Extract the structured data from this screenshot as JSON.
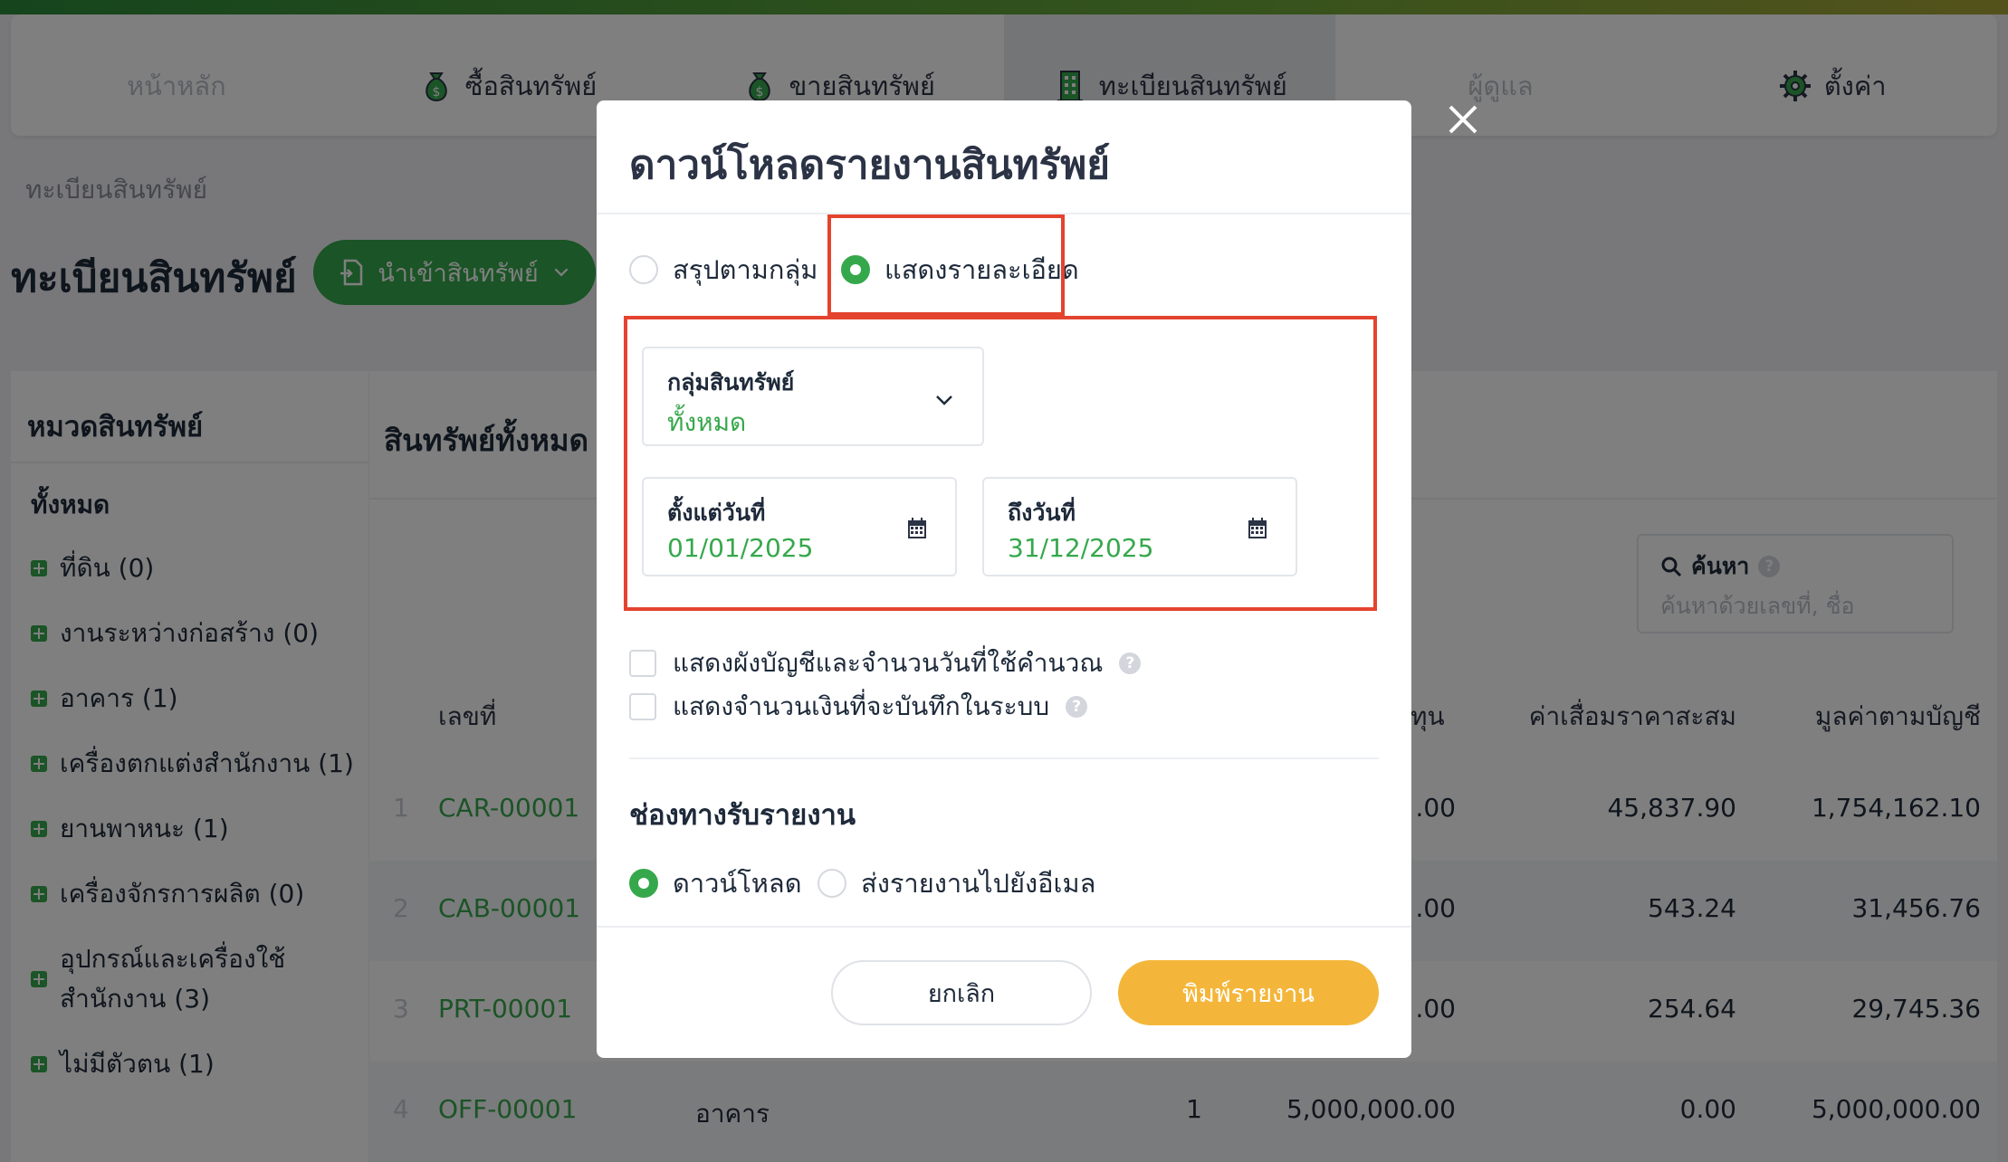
{
  "nav": {
    "items": [
      {
        "label": "หน้าหลัก",
        "icon": "home-icon"
      },
      {
        "label": "ซื้อสินทรัพย์",
        "icon": "money-bag-icon"
      },
      {
        "label": "ขายสินทรัพย์",
        "icon": "money-bag-icon"
      },
      {
        "label": "ทะเบียนสินทรัพย์",
        "icon": "building-icon"
      },
      {
        "label": "ผู้ดูแล",
        "icon": "person-icon"
      },
      {
        "label": "ตั้งค่า",
        "icon": "gear-icon"
      }
    ]
  },
  "breadcrumb": "ทะเบียนสินทรัพย์",
  "page_title": "ทะเบียนสินทรัพย์",
  "import_button": "นำเข้าสินทรัพย์",
  "sidebar": {
    "title": "หมวดสินทรัพย์",
    "all": "ทั้งหมด",
    "items": [
      {
        "label": "ที่ดิน (0)"
      },
      {
        "label": "งานระหว่างก่อสร้าง (0)"
      },
      {
        "label": "อาคาร (1)"
      },
      {
        "label": "เครื่องตกแต่งสำนักงาน (1)"
      },
      {
        "label": "ยานพาหนะ (1)"
      },
      {
        "label": "เครื่องจักรการผลิต (0)"
      },
      {
        "label": "อุปกรณ์และเครื่องใช้",
        "label2": "สำนักงาน (3)"
      },
      {
        "label": "ไม่มีตัวตน (1)"
      }
    ]
  },
  "main": {
    "title": "สินทรัพย์ทั้งหมด",
    "search": {
      "label": "ค้นหา",
      "placeholder": "ค้นหาด้วยเลขที่, ชื่อ"
    },
    "columns": {
      "no": "เลขที่",
      "cost": "ทุน",
      "depreciation": "ค่าเสื่อมราคาสะสม",
      "book_value": "มูลค่าตามบัญชี"
    },
    "rows": [
      {
        "idx": "1",
        "code": "CAR-00001",
        "cat": "",
        "qty": "",
        "cost": ".00",
        "dep": "45,837.90",
        "book": "1,754,162.10"
      },
      {
        "idx": "2",
        "code": "CAB-00001",
        "cat": "",
        "qty": "",
        "cost": ".00",
        "dep": "543.24",
        "book": "31,456.76"
      },
      {
        "idx": "3",
        "code": "PRT-00001",
        "cat": "",
        "qty": "",
        "cost": ".00",
        "dep": "254.64",
        "book": "29,745.36"
      },
      {
        "idx": "4",
        "code": "OFF-00001",
        "cat": "อาคาร",
        "qty": "1",
        "cost": "5,000,000.00",
        "dep": "0.00",
        "book": "5,000,000.00"
      }
    ]
  },
  "modal": {
    "title": "ดาวน์โหลดรายงานสินทรัพย์",
    "type_options": {
      "summary": "สรุปตามกลุ่ม",
      "detail": "แสดงรายละเอียด"
    },
    "group_field": {
      "label": "กลุ่มสินทรัพย์",
      "value": "ทั้งหมด"
    },
    "from_field": {
      "label": "ตั้งแต่วันที่",
      "value": "01/01/2025"
    },
    "to_field": {
      "label": "ถึงวันที่",
      "value": "31/12/2025"
    },
    "checkbox_chart": "แสดงผังบัญชีและจำนวนวันที่ใช้คำนวณ",
    "checkbox_amount": "แสดงจำนวนเงินที่จะบันทึกในระบบ",
    "channel_title": "ช่องทางรับรายงาน",
    "channel_options": {
      "download": "ดาวน์โหลด",
      "email": "ส่งรายงานไปยังอีเมล"
    },
    "cancel": "ยกเลิก",
    "print": "พิมพ์รายงาน"
  },
  "colors": {
    "brand_green": "#36a84c",
    "print_orange": "#f4b63a",
    "highlight_red": "#e4442f"
  }
}
